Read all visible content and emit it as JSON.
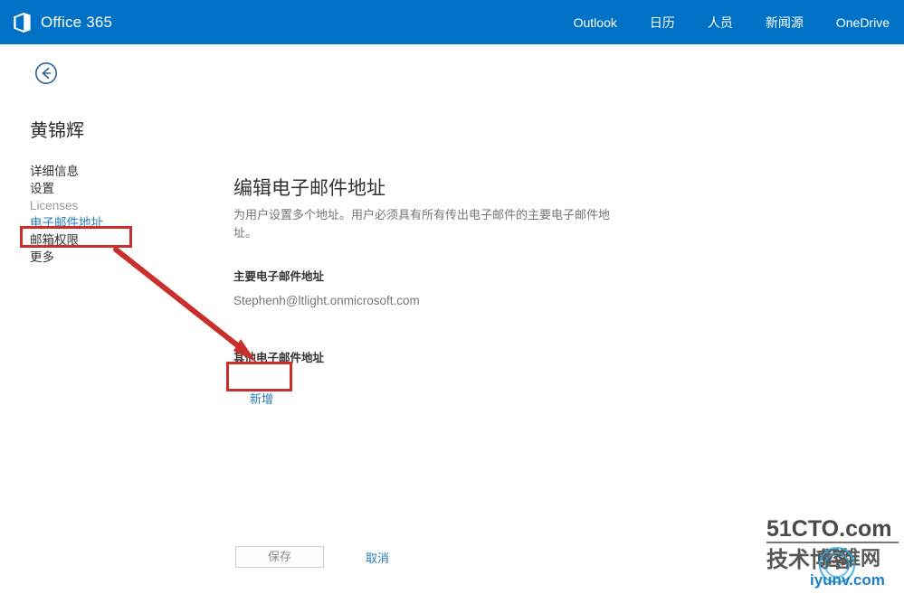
{
  "suite": {
    "brand": "Office 365",
    "brand_logo_icon": "office-logo-icon",
    "bar_color": "#0072c6",
    "nav": [
      {
        "label": "Outlook",
        "name": "outlook"
      },
      {
        "label": "日历",
        "name": "calendar"
      },
      {
        "label": "人员",
        "name": "people"
      },
      {
        "label": "新闻源",
        "name": "newsfeed"
      },
      {
        "label": "OneDrive",
        "name": "onedrive"
      }
    ]
  },
  "back": {
    "icon": "back-arrow-circle-icon",
    "color": "#2a6496"
  },
  "user": {
    "name": "黄锦辉"
  },
  "sidebar": {
    "items": [
      {
        "label": "详细信息",
        "name": "details",
        "state": "normal"
      },
      {
        "label": "设置",
        "name": "settings",
        "state": "normal"
      },
      {
        "label": "Licenses",
        "name": "licenses",
        "state": "muted"
      },
      {
        "label": "电子邮件地址",
        "name": "email-addresses",
        "state": "active"
      },
      {
        "label": "邮箱权限",
        "name": "mailbox-permissions",
        "state": "normal"
      },
      {
        "label": "更多",
        "name": "more",
        "state": "normal"
      }
    ]
  },
  "main": {
    "title": "编辑电子邮件地址",
    "description": "为用户设置多个地址。用户必须具有所有传出电子邮件的主要电子邮件地址。",
    "primary_label": "主要电子邮件地址",
    "primary_email": "Stephenh@ltlight.onmicrosoft.com",
    "secondary_label": "其他电子邮件地址",
    "add_label": "新增"
  },
  "footer": {
    "save_label": "保存",
    "cancel_label": "取消"
  },
  "annotations": {
    "color": "#c9302c",
    "box_sidebar_target": "电子邮件地址",
    "box_add_target": "新增",
    "arrow_icon": "red-arrow-icon"
  },
  "watermark": {
    "line1": "51CTO.com",
    "line2": "技术博客",
    "line3": "运维网",
    "line4": "iyunv.com"
  }
}
